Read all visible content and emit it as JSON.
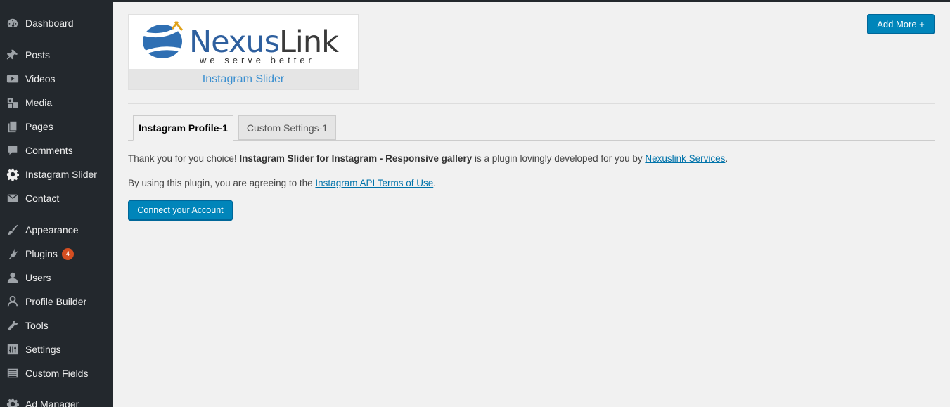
{
  "sidebar": {
    "items": [
      {
        "label": "Dashboard",
        "icon": "dashboard-icon"
      },
      {
        "label": "Posts",
        "icon": "pin-icon"
      },
      {
        "label": "Videos",
        "icon": "video-icon"
      },
      {
        "label": "Media",
        "icon": "media-icon"
      },
      {
        "label": "Pages",
        "icon": "pages-icon"
      },
      {
        "label": "Comments",
        "icon": "comment-icon"
      },
      {
        "label": "Instagram Slider",
        "icon": "gear-icon"
      },
      {
        "label": "Contact",
        "icon": "mail-icon"
      },
      {
        "label": "Appearance",
        "icon": "brush-icon"
      },
      {
        "label": "Plugins",
        "icon": "plugin-icon",
        "badge": "4"
      },
      {
        "label": "Users",
        "icon": "users-icon"
      },
      {
        "label": "Profile Builder",
        "icon": "user-icon"
      },
      {
        "label": "Tools",
        "icon": "wrench-icon"
      },
      {
        "label": "Settings",
        "icon": "settings-icon"
      },
      {
        "label": "Custom Fields",
        "icon": "fields-icon"
      },
      {
        "label": "Ad Manager",
        "icon": "gear-icon"
      }
    ]
  },
  "logo": {
    "brand_first": "Nexus",
    "brand_second": "Link",
    "tagline": "we serve better",
    "caption": "Instagram Slider"
  },
  "header": {
    "add_more_label": "Add More +"
  },
  "tabs": [
    {
      "label": "Instagram Profile-1",
      "active": true
    },
    {
      "label": "Custom Settings-1",
      "active": false
    }
  ],
  "content": {
    "intro_prefix": "Thank you for you choice! ",
    "plugin_name": "Instagram Slider for Instagram - Responsive gallery",
    "intro_middle": " is a plugin lovingly developed for you by ",
    "developer_link": "Nexuslink Services",
    "intro_suffix": ".",
    "terms_prefix": "By using this plugin, you are agreeing to the ",
    "terms_link": "Instagram API Terms of Use",
    "terms_suffix": ".",
    "connect_label": "Connect your Account"
  },
  "colors": {
    "sidebar_bg": "#23282d",
    "primary_button": "#0085ba",
    "link": "#0073aa",
    "badge": "#d54e21"
  }
}
